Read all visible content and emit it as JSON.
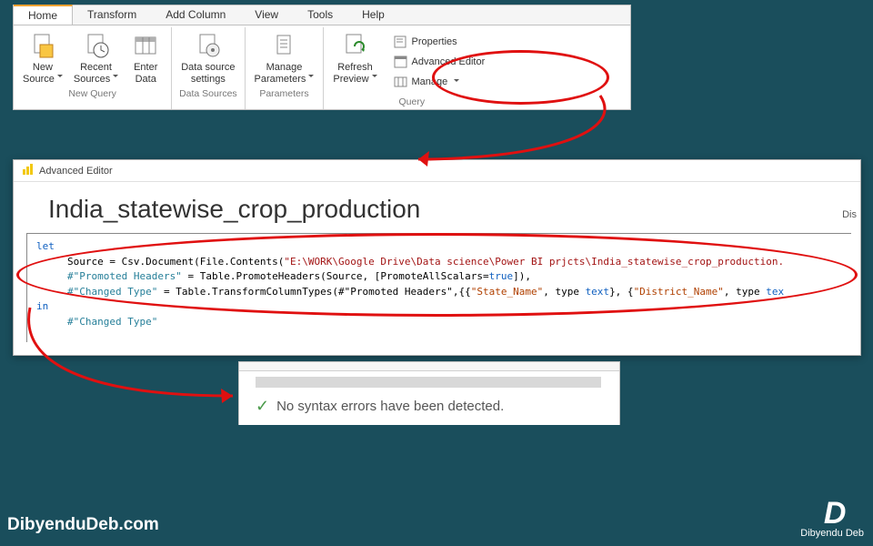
{
  "ribbon": {
    "tabs": [
      "Home",
      "Transform",
      "Add Column",
      "View",
      "Tools",
      "Help"
    ],
    "active_tab": "Home",
    "groups": {
      "new_query": {
        "label": "New Query",
        "new_source": "New\nSource",
        "recent_sources": "Recent\nSources",
        "enter_data": "Enter\nData"
      },
      "data_sources": {
        "label": "Data Sources",
        "settings": "Data source\nsettings"
      },
      "parameters": {
        "label": "Parameters",
        "manage": "Manage\nParameters"
      },
      "query": {
        "label": "Query",
        "refresh": "Refresh\nPreview",
        "properties": "Properties",
        "advanced": "Advanced Editor",
        "manage": "Manage"
      }
    }
  },
  "editor": {
    "title": "Advanced Editor",
    "query_name": "India_statewise_crop_production",
    "dis": "Dis",
    "code": {
      "let": "let",
      "source_lhs": "Source = ",
      "source_fn": "Csv.Document(File.Contents(",
      "source_path": "\"E:\\WORK\\Google Drive\\Data science\\Power BI prjcts\\India_statewise_crop_production.",
      "promoted_lhs": "#\"Promoted Headers\"",
      "promoted_rhs_a": " = Table.PromoteHeaders(Source, [PromoteAllScalars=",
      "promoted_true": "true",
      "promoted_rhs_b": "]),",
      "changed_lhs": "#\"Changed Type\"",
      "changed_rhs_a": " = Table.TransformColumnTypes(#\"Promoted Headers\",{{",
      "changed_f1": "\"State_Name\"",
      "changed_mid": ", type ",
      "changed_t1": "text",
      "changed_b": "}, {",
      "changed_f2": "\"District_Name\"",
      "changed_t2": "tex",
      "in": "in",
      "final": "#\"Changed Type\""
    }
  },
  "status": {
    "message": "No syntax errors have been detected."
  },
  "footer": {
    "site": "DibyenduDeb.com",
    "name": "Dibyendu Deb"
  }
}
